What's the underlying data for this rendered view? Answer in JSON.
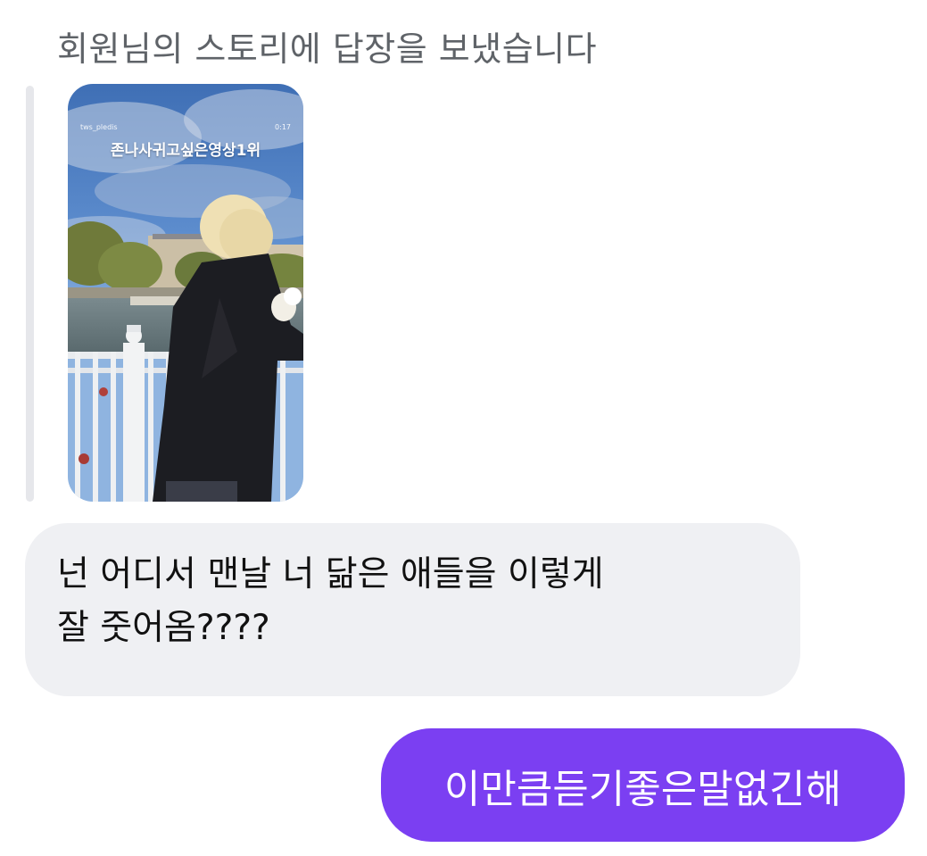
{
  "reply_header": "회원님의 스토리에 답장을 보냈습니다",
  "story": {
    "username": "tws_pledis",
    "time": "0:17",
    "caption": "존나사귀고싶은영상1위"
  },
  "incoming_message": {
    "lines": [
      "넌 어디서 맨날 너 닮은 애들을 이렇게",
      "잘 줏어옴????"
    ]
  },
  "outgoing_message": {
    "text": "이만큼듣기좋은말없긴해"
  },
  "colors": {
    "outgoing_bubble": "#7b3ff2",
    "incoming_bubble": "#eff0f3",
    "quote_bar": "#e6e7eb",
    "header_text": "#5f6368"
  }
}
